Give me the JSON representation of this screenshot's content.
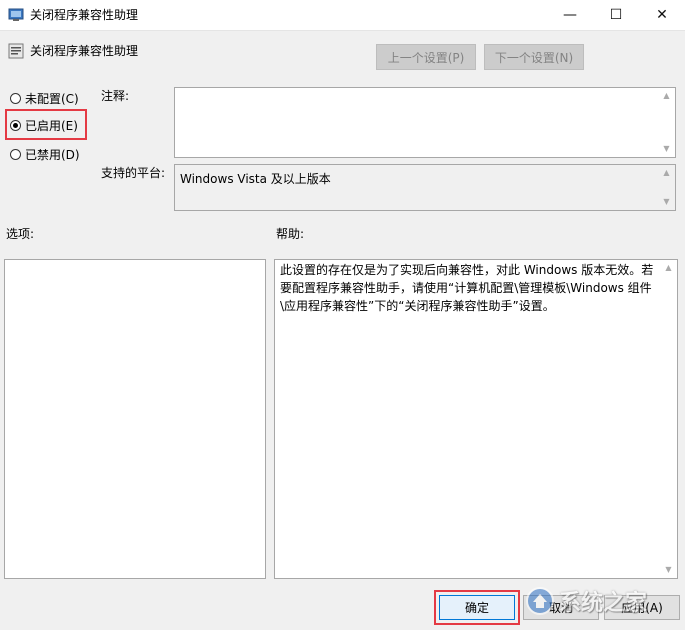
{
  "window": {
    "title": "关闭程序兼容性助理",
    "controls": {
      "minimize": "—",
      "maximize": "☐",
      "close": "✕"
    }
  },
  "header": {
    "policy_title": "关闭程序兼容性助理",
    "prev_setting": "上一个设置(P)",
    "next_setting": "下一个设置(N)"
  },
  "state": {
    "options": [
      {
        "label": "未配置(C)",
        "selected": false
      },
      {
        "label": "已启用(E)",
        "selected": true
      },
      {
        "label": "已禁用(D)",
        "selected": false
      }
    ]
  },
  "labels": {
    "comment": "注释:",
    "supported_platform": "支持的平台:",
    "options": "选项:",
    "help": "帮助:"
  },
  "fields": {
    "comment": "",
    "supported_platform": "Windows Vista 及以上版本"
  },
  "help_text": "此设置的存在仅是为了实现后向兼容性，对此 Windows 版本无效。若要配置程序兼容性助手，请使用“计算机配置\\管理模板\\Windows 组件\\应用程序兼容性”下的“关闭程序兼容性助手”设置。",
  "buttons": {
    "ok": "确定",
    "cancel": "取消",
    "apply": "应用(A)"
  },
  "watermark": {
    "text": "系统之家"
  },
  "colors": {
    "highlight": "#e43a44",
    "focus": "#0078d7"
  }
}
